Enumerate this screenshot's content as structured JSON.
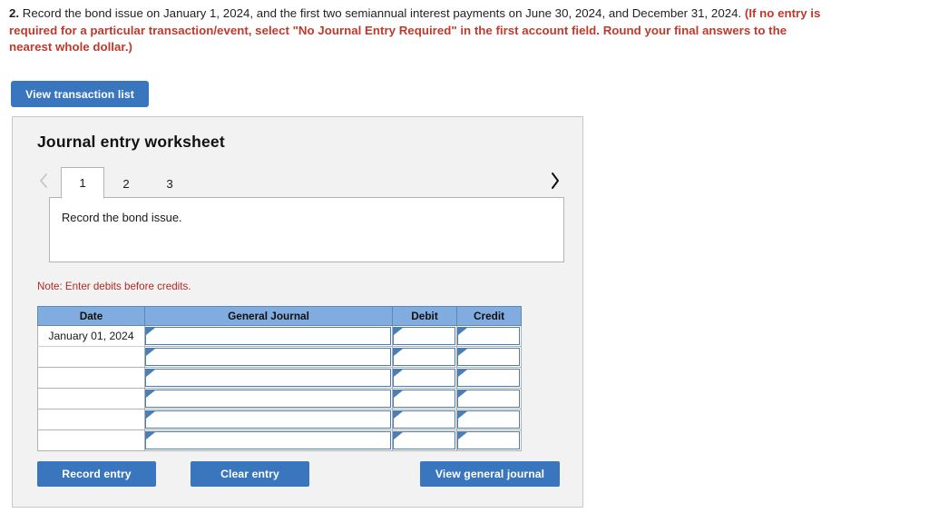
{
  "prompt": {
    "number": "2.",
    "black_text": " Record the bond issue on January 1, 2024, and the first two semiannual interest payments on June 30, 2024, and December 31, 2024. ",
    "red_text": "(If no entry is required for a particular transaction/event, select \"No Journal Entry Required\" in the first account field. Round your final answers to the nearest whole dollar.)"
  },
  "toolbar": {
    "view_transaction_list_label": "View transaction list"
  },
  "worksheet": {
    "title": "Journal entry worksheet",
    "prev_icon": "chevron-left-icon",
    "next_icon": "chevron-right-icon",
    "tabs": [
      {
        "label": "1",
        "active": true
      },
      {
        "label": "2",
        "active": false
      },
      {
        "label": "3",
        "active": false
      }
    ],
    "description": "Record the bond issue.",
    "note": "Note: Enter debits before credits.",
    "table": {
      "headers": [
        "Date",
        "General Journal",
        "Debit",
        "Credit"
      ],
      "rows": [
        {
          "date": "January 01, 2024",
          "general_journal": "",
          "debit": "",
          "credit": ""
        },
        {
          "date": "",
          "general_journal": "",
          "debit": "",
          "credit": ""
        },
        {
          "date": "",
          "general_journal": "",
          "debit": "",
          "credit": ""
        },
        {
          "date": "",
          "general_journal": "",
          "debit": "",
          "credit": ""
        },
        {
          "date": "",
          "general_journal": "",
          "debit": "",
          "credit": ""
        },
        {
          "date": "",
          "general_journal": "",
          "debit": "",
          "credit": ""
        }
      ]
    },
    "buttons": {
      "record_entry": "Record entry",
      "clear_entry": "Clear entry",
      "view_general_journal": "View general journal"
    }
  },
  "colors": {
    "accent_blue": "#3a76bd",
    "header_blue": "#80ace0",
    "alert_red": "#c0392b",
    "note_red": "#b02a24",
    "panel_bg": "#f2f2f2"
  }
}
